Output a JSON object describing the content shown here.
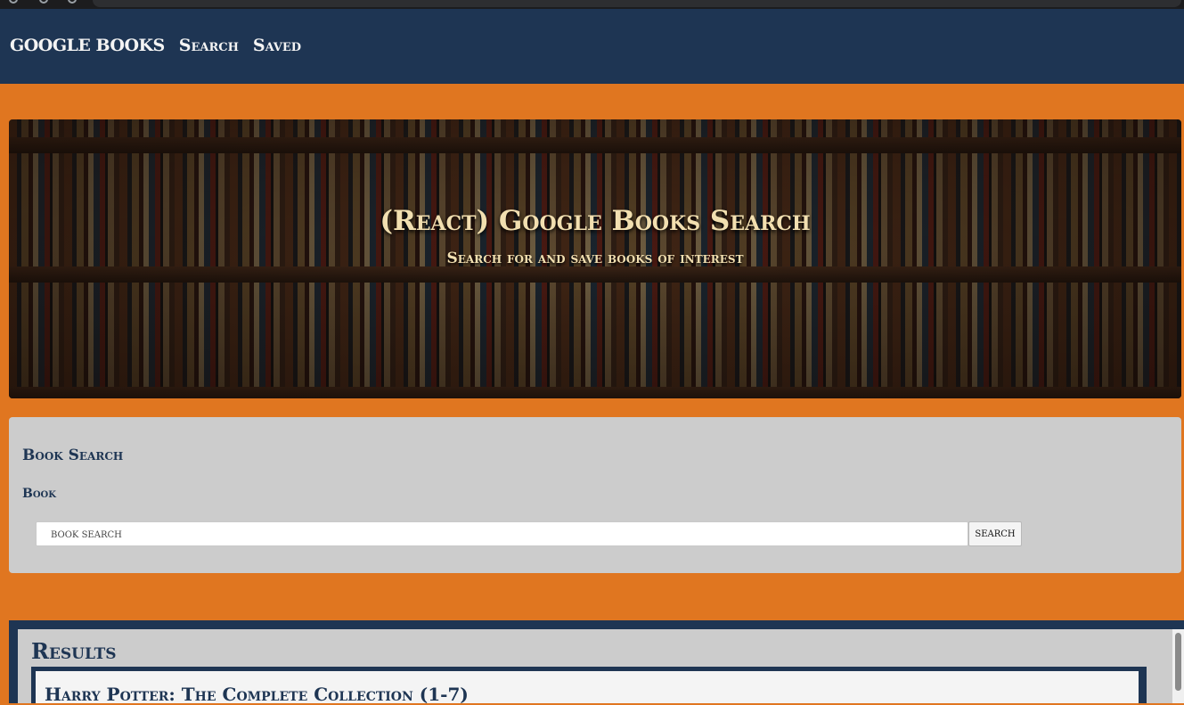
{
  "navbar": {
    "brand": "GOOGLE BOOKS",
    "links": [
      "Search",
      "Saved"
    ]
  },
  "hero": {
    "title": "(React) Google Books Search",
    "subtitle": "Search for and save books of interest"
  },
  "search_card": {
    "title": "Book Search",
    "field_label": "Book",
    "input_placeholder": "book search",
    "input_value": "",
    "button_label": "search"
  },
  "results": {
    "title": "Results",
    "books": [
      {
        "title": "Harry Potter: The Complete Collection (1-7)"
      }
    ]
  },
  "colors": {
    "navbar": "#1e3553",
    "page_background": "#e07620",
    "card_background": "#cccccc",
    "hero_text": "#f2dfb0"
  }
}
